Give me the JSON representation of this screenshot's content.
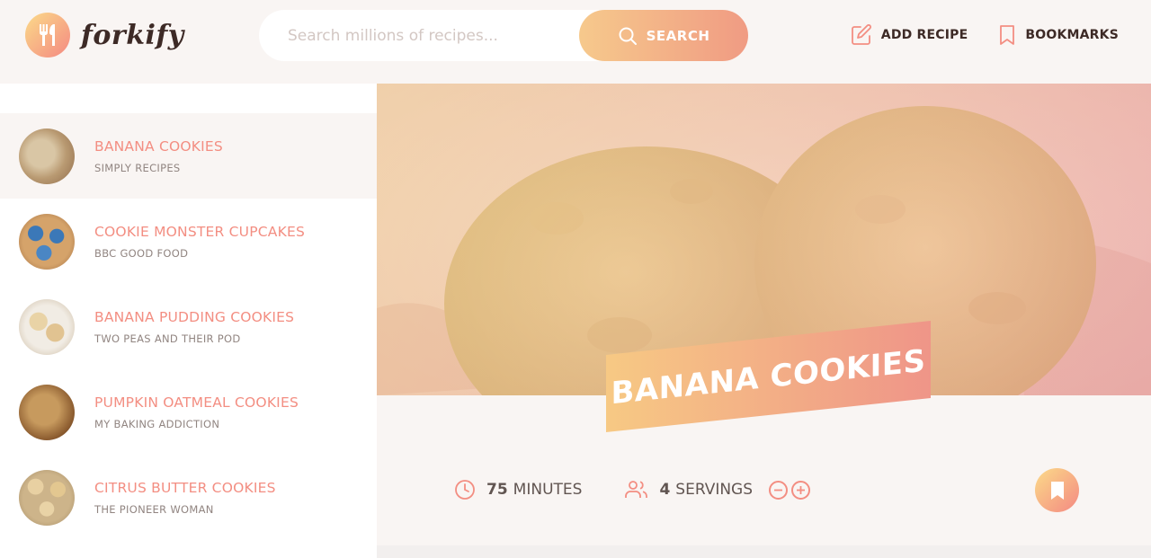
{
  "app": {
    "logo_text": "forkify",
    "logo_icon": "fork-knife-icon"
  },
  "search": {
    "placeholder": "Search millions of recipes...",
    "button_label": "SEARCH"
  },
  "nav": {
    "add_recipe_label": "ADD RECIPE",
    "bookmarks_label": "BOOKMARKS"
  },
  "colors": {
    "accent": "#f38e82",
    "gradient_start": "#fbdb89",
    "gradient_end": "#f48982"
  },
  "results": [
    {
      "title": "Banana Cookies",
      "publisher": "Simply Recipes",
      "active": true
    },
    {
      "title": "Cookie Monster Cupcakes",
      "publisher": "BBC Good Food",
      "active": false
    },
    {
      "title": "Banana Pudding Cookies",
      "publisher": "Two Peas and Their Pod",
      "active": false
    },
    {
      "title": "Pumpkin Oatmeal Cookies",
      "publisher": "My Baking Addiction",
      "active": false
    },
    {
      "title": "Citrus Butter Cookies",
      "publisher": "The Pioneer Woman",
      "active": false
    }
  ],
  "recipe": {
    "title": "Banana Cookies",
    "cooking_time": "75",
    "cooking_unit": "MINUTES",
    "servings": "4",
    "servings_unit": "SERVINGS"
  }
}
